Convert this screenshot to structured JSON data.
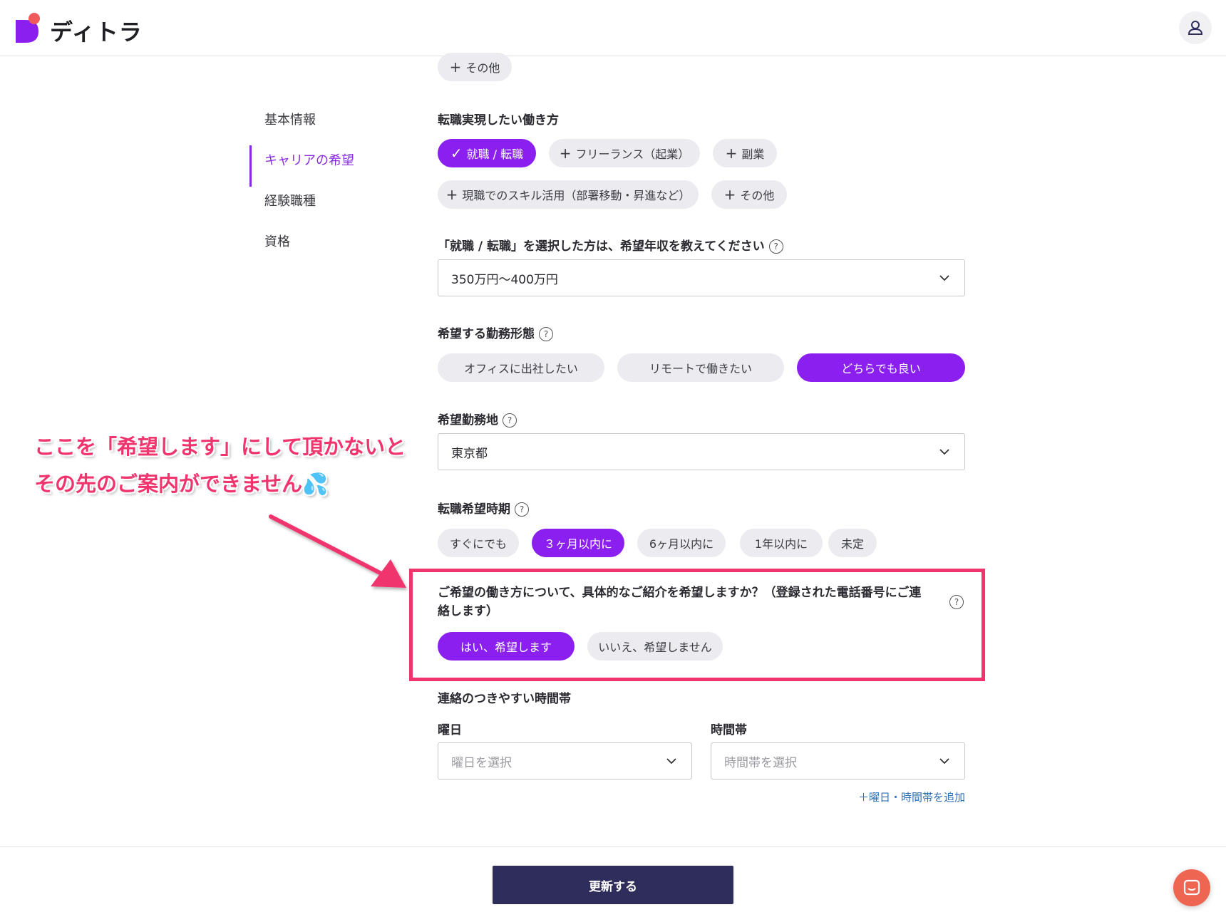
{
  "header": {
    "brand": "ディトラ"
  },
  "sidebar": {
    "items": [
      {
        "label": "基本情報"
      },
      {
        "label": "キャリアの希望"
      },
      {
        "label": "経験職種"
      },
      {
        "label": "資格"
      }
    ]
  },
  "top_chip": {
    "label": "その他"
  },
  "work_style": {
    "title": "転職実現したい働き方",
    "options": [
      {
        "label": "就職 / 転職",
        "selected": true
      },
      {
        "label": "フリーランス（起業）",
        "selected": false
      },
      {
        "label": "副業",
        "selected": false
      },
      {
        "label": "現職でのスキル活用（部署移動・昇進など）",
        "selected": false
      },
      {
        "label": "その他",
        "selected": false
      }
    ]
  },
  "salary": {
    "title": "「就職 / 転職」を選択した方は、希望年収を教えてください",
    "value": "350万円〜400万円"
  },
  "work_form": {
    "title": "希望する勤務形態",
    "options": [
      {
        "label": "オフィスに出社したい",
        "selected": false
      },
      {
        "label": "リモートで働きたい",
        "selected": false
      },
      {
        "label": "どちらでも良い",
        "selected": true
      }
    ]
  },
  "location": {
    "title": "希望勤務地",
    "value": "東京都"
  },
  "timing": {
    "title": "転職希望時期",
    "options": [
      {
        "label": "すぐにでも",
        "selected": false
      },
      {
        "label": "３ヶ月以内に",
        "selected": true
      },
      {
        "label": "6ヶ月以内に",
        "selected": false
      },
      {
        "label": "1年以内に",
        "selected": false
      },
      {
        "label": "未定",
        "selected": false
      }
    ]
  },
  "referral": {
    "title_line1": "ご希望の働き方について、具体的なご紹介を希望しますか？（登録された電話番号にご連",
    "title_line2": "絡します）",
    "options": [
      {
        "label": "はい、希望します",
        "selected": true
      },
      {
        "label": "いいえ、希望しません",
        "selected": false
      }
    ]
  },
  "contact": {
    "title": "連絡のつきやすい時間帯",
    "day_label": "曜日",
    "day_placeholder": "曜日を選択",
    "time_label": "時間帯",
    "time_placeholder": "時間帯を選択",
    "add_link": "＋曜日・時間帯を追加"
  },
  "annotation": {
    "line1": "ここを「希望します」にして頂かないと",
    "line2": "その先のご案内ができません💦"
  },
  "footer": {
    "submit_label": "更新する"
  },
  "colors": {
    "accent": "#8a1ff0",
    "annotation": "#f0356e",
    "submit": "#2e2d5c",
    "chat": "#ee6552"
  }
}
